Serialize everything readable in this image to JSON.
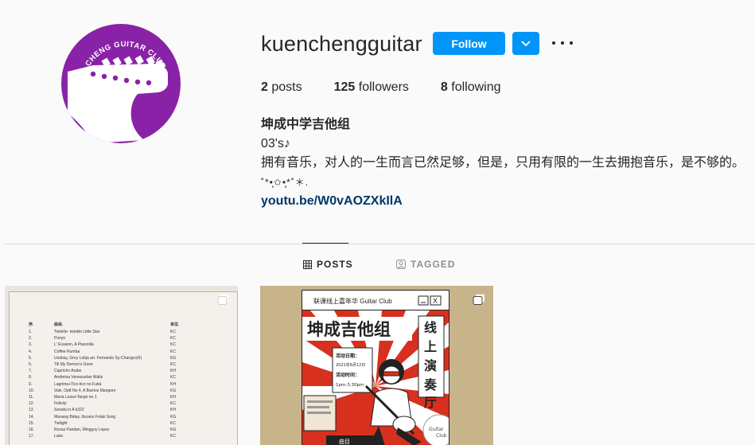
{
  "profile": {
    "username": "kuenchengguitar",
    "avatar_text": "@KUEN CHENG GUITAR CLUB",
    "follow_label": "Follow",
    "stats": {
      "posts_count": "2",
      "posts_label": "posts",
      "followers_count": "125",
      "followers_label": "followers",
      "following_count": "8",
      "following_label": "following"
    },
    "bio": {
      "name": "坤成中学吉他组",
      "line1": "03's♪",
      "line2": "拥有音乐，对人的一生而言已然足够，但是，只用有限的一生去拥抱音乐，是不够的。",
      "line3": "˚*•̩̩͙✩•̩̩͙*˚＊.",
      "link": "youtu.be/W0vAOZXkIlA"
    }
  },
  "tabs": [
    {
      "label": "POSTS",
      "icon": "grid-icon",
      "active": true
    },
    {
      "label": "TAGGED",
      "icon": "tag-person-icon",
      "active": false
    }
  ],
  "posts": {
    "post1": {
      "header": [
        "序.",
        "曲目.",
        "单位."
      ],
      "rows": [
        [
          "1.",
          "Twinkle- twinkle Little Star",
          "KC"
        ],
        [
          "2.",
          "Ponyo",
          "KC"
        ],
        [
          "3.",
          "L'    Evasion, A Piazzolla",
          "KC"
        ],
        [
          "4.",
          "Coffee Rumba",
          "KC"
        ],
        [
          "5.",
          "Usahay, Grey Lobja arr. Fernando Sy-Changco(II)",
          "KG"
        ],
        [
          "6.",
          "Till My Demon's Gone",
          "KC"
        ],
        [
          "7.",
          "Capricho Arabe",
          "KH"
        ],
        [
          "8.",
          "Andreina Venezuelan Waltz",
          "KC"
        ],
        [
          "9.",
          "Lagrima+Tico-tico no Fubá",
          "KH"
        ],
        [
          "10.",
          "Vals, Op8 No 4, A Barrios Mangore",
          "KG"
        ],
        [
          "11.",
          "Maria Luisa+Tango no 1",
          "KH"
        ],
        [
          "12.",
          "Felicity",
          "KC"
        ],
        [
          "13.",
          "Sonata in A k322",
          "KH"
        ],
        [
          "14.",
          "Manang Biday, Ilocano Folak Song",
          "KG"
        ],
        [
          "15.",
          "Twilight",
          "KC"
        ],
        [
          "16.",
          "Rosas Pandan, Minggoy Lopez",
          "KG"
        ],
        [
          "17.",
          "Luka",
          "KC"
        ]
      ]
    },
    "post2": {
      "topbar": "联课线上嘉年华 Guitar Club",
      "title": "坤成吉他组",
      "side_title": "线上演奏厅",
      "date_label": "活动日期：",
      "date_value": "2021年6月12日",
      "time_label": "活动时间：",
      "time_value": "1pm-3.30pm",
      "badge_top": "Guitar",
      "badge_bottom": "Club",
      "footer": "曲目"
    }
  },
  "colors": {
    "accent": "#0095f6",
    "avatar_bg": "#8a22a7",
    "link": "#00376b",
    "poster_red": "#d8301e"
  }
}
